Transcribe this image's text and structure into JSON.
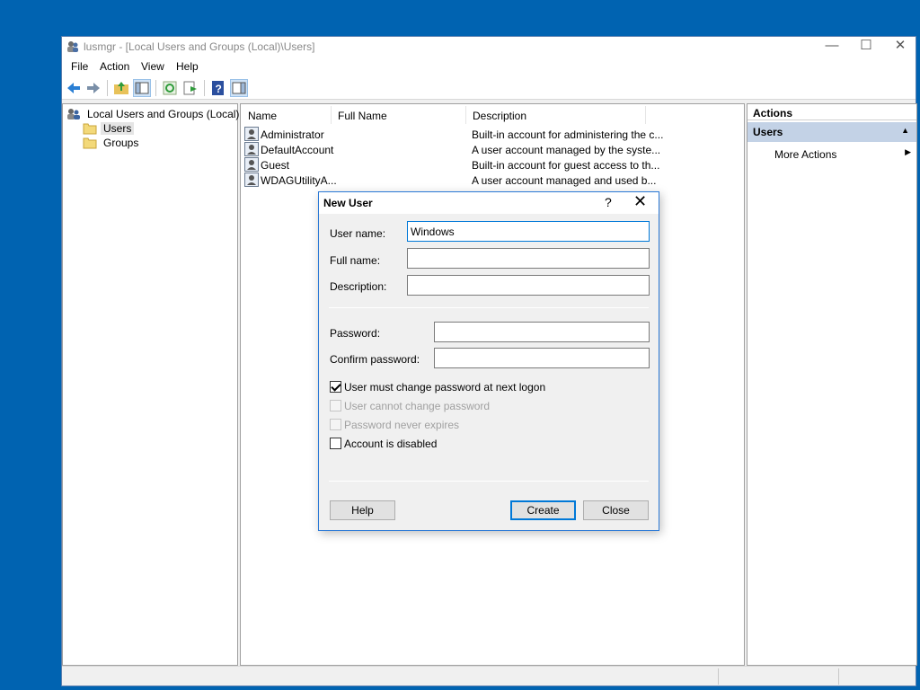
{
  "window": {
    "title": "lusmgr - [Local Users and Groups (Local)\\Users]",
    "minimize": "—",
    "maximize": "☐",
    "close": "✕"
  },
  "menu": [
    "File",
    "Action",
    "View",
    "Help"
  ],
  "tree": {
    "root": "Local Users and Groups (Local)",
    "items": [
      "Users",
      "Groups"
    ],
    "selected": "Users"
  },
  "list": {
    "columns": [
      "Name",
      "Full Name",
      "Description"
    ],
    "rows": [
      {
        "name": "Administrator",
        "full_name": "",
        "description": "Built-in account for administering the c..."
      },
      {
        "name": "DefaultAccount",
        "full_name": "",
        "description": "A user account managed by the syste..."
      },
      {
        "name": "Guest",
        "full_name": "",
        "description": "Built-in account for guest access to th..."
      },
      {
        "name": "WDAGUtilityA...",
        "full_name": "",
        "description": "A user account managed and used b..."
      }
    ]
  },
  "actions": {
    "header": "Actions",
    "section": "Users",
    "more": "More Actions"
  },
  "dialog": {
    "title": "New User",
    "help_glyph": "?",
    "close_glyph": "✕",
    "fields": {
      "user_name": {
        "label": "User name:",
        "value": "Windows"
      },
      "full_name": {
        "label": "Full name:",
        "value": ""
      },
      "description": {
        "label": "Description:",
        "value": ""
      },
      "password": {
        "label": "Password:",
        "value": ""
      },
      "confirm_password": {
        "label": "Confirm password:",
        "value": ""
      }
    },
    "checkboxes": [
      {
        "label": "User must change password at next logon",
        "checked": true,
        "enabled": true
      },
      {
        "label": "User cannot change password",
        "checked": false,
        "enabled": false
      },
      {
        "label": "Password never expires",
        "checked": false,
        "enabled": false
      },
      {
        "label": "Account is disabled",
        "checked": false,
        "enabled": true
      }
    ],
    "buttons": {
      "help": "Help",
      "create": "Create",
      "close": "Close"
    }
  },
  "colors": {
    "desktop": "#0063b1",
    "dialog_border": "#2b79d6",
    "accent": "#0078d7"
  }
}
